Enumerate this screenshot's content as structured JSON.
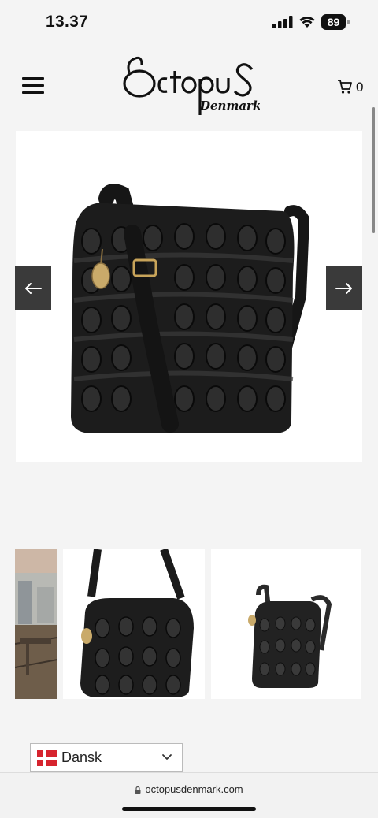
{
  "status_bar": {
    "time": "13.37",
    "battery": "89"
  },
  "header": {
    "logo_main": "OctopuS",
    "logo_sub": "Denmark",
    "cart_count": "0"
  },
  "icons": {
    "menu": "hamburger-menu-icon",
    "cart": "shopping-cart-icon",
    "arrow_left": "arrow-left-icon",
    "arrow_right": "arrow-right-icon"
  },
  "gallery": {
    "main_image_alt": "Black woven leather crossbody bag",
    "thumbnails": [
      "building-balcony-photo",
      "bag-front-photo",
      "bag-side-photo"
    ]
  },
  "language": {
    "selected": "Dansk"
  },
  "browser": {
    "url": "octopusdenmark.com"
  }
}
